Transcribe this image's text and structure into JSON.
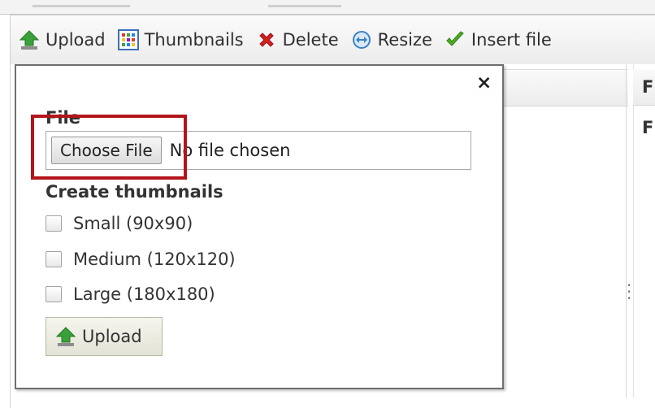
{
  "toolbar": {
    "upload_label": "Upload",
    "thumbnails_label": "Thumbnails",
    "delete_label": "Delete",
    "resize_label": "Resize",
    "insert_file_label": "Insert file"
  },
  "dialog": {
    "close_symbol": "×",
    "file_label": "File",
    "choose_file_label": "Choose File",
    "no_file_text": "No file chosen",
    "thumbnails_heading": "Create thumbnails",
    "options": [
      {
        "label": "Small (90x90)",
        "checked": false
      },
      {
        "label": "Medium (120x120)",
        "checked": false
      },
      {
        "label": "Large (180x180)",
        "checked": false
      }
    ],
    "upload_button_label": "Upload"
  },
  "right_panel": {
    "header_fragment": "Fi",
    "row_fragment": "Fi"
  },
  "icons": {
    "upload": "upload-arrow-icon",
    "thumbnails": "thumbnails-grid-icon",
    "delete": "delete-x-icon",
    "resize": "resize-icon",
    "insert_file": "checkmark-icon"
  },
  "colors": {
    "highlight_border": "#b3151b",
    "upload_green": "#3aa13a",
    "delete_red": "#d42020",
    "resize_blue": "#3b82c4",
    "check_green": "#4caf20"
  }
}
